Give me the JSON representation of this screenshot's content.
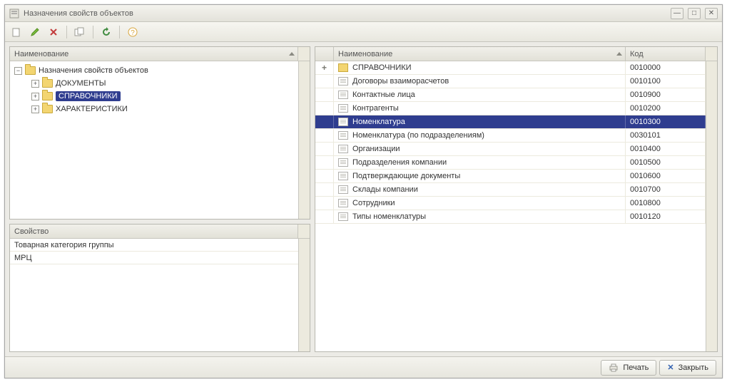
{
  "window": {
    "title": "Назначения свойств объектов"
  },
  "toolbar": {
    "icons": [
      "new",
      "edit",
      "delete",
      "copy",
      "refresh",
      "help"
    ]
  },
  "tree": {
    "header": "Наименование",
    "root": {
      "label": "Назначения свойств объектов",
      "children": [
        {
          "label": "ДОКУМЕНТЫ",
          "expandable": true
        },
        {
          "label": "СПРАВОЧНИКИ",
          "expandable": true,
          "selected": true
        },
        {
          "label": "ХАРАКТЕРИСТИКИ",
          "expandable": true
        }
      ]
    }
  },
  "properties": {
    "header": "Свойство",
    "rows": [
      "Товарная категория группы",
      "МРЦ"
    ]
  },
  "grid": {
    "columns": {
      "mark": "",
      "name": "Наименование",
      "code": "Код"
    },
    "rows": [
      {
        "folder": true,
        "mark": "+",
        "name": "СПРАВОЧНИКИ",
        "code": "0010000"
      },
      {
        "folder": false,
        "mark": "",
        "name": "Договоры взаиморасчетов",
        "code": "0010100"
      },
      {
        "folder": false,
        "mark": "",
        "name": "Контактные лица",
        "code": "0010900"
      },
      {
        "folder": false,
        "mark": "",
        "name": "Контрагенты",
        "code": "0010200"
      },
      {
        "folder": false,
        "mark": "",
        "name": "Номенклатура",
        "selected": true,
        "code": "0010300"
      },
      {
        "folder": false,
        "mark": "",
        "name": "Номенклатура (по подразделениям)",
        "code": "0030101"
      },
      {
        "folder": false,
        "mark": "",
        "name": "Организации",
        "code": "0010400"
      },
      {
        "folder": false,
        "mark": "",
        "name": "Подразделения компании",
        "code": "0010500"
      },
      {
        "folder": false,
        "mark": "",
        "name": "Подтверждающие документы",
        "code": "0010600"
      },
      {
        "folder": false,
        "mark": "",
        "name": "Склады компании",
        "code": "0010700"
      },
      {
        "folder": false,
        "mark": "",
        "name": "Сотрудники",
        "code": "0010800"
      },
      {
        "folder": false,
        "mark": "",
        "name": "Типы номенклатуры",
        "code": "0010120"
      }
    ]
  },
  "footer": {
    "print": "Печать",
    "close": "Закрыть"
  }
}
